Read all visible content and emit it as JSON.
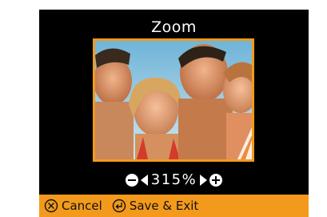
{
  "screen": {
    "title": "Zoom",
    "accent_color": "#f39a1c",
    "photo": {
      "description_icon": "photo-preview"
    },
    "zoom": {
      "value": "315%",
      "decrease_icon": "minus-circle-icon",
      "increase_icon": "plus-circle-icon",
      "left_arrow_icon": "triangle-left-icon",
      "right_arrow_icon": "triangle-right-icon"
    },
    "footer": {
      "cancel_label": "Cancel",
      "cancel_icon": "circle-x-icon",
      "save_label": "Save & Exit",
      "save_icon": "enter-arrow-icon"
    }
  }
}
